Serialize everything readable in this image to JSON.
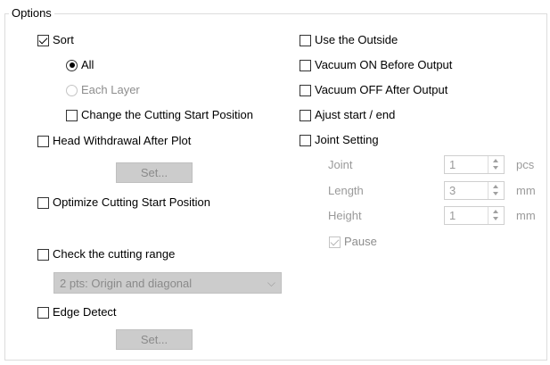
{
  "group_title": "Options",
  "left": {
    "sort": {
      "label": "Sort",
      "checked": true
    },
    "radio_all": {
      "label": "All",
      "checked": true
    },
    "radio_each_layer": {
      "label": "Each Layer",
      "checked": false
    },
    "change_start": {
      "label": "Change the Cutting Start Position",
      "checked": false
    },
    "head_withdrawal": {
      "label": "Head Withdrawal After Plot",
      "checked": false
    },
    "head_set_button": "Set...",
    "optimize_start": {
      "label": "Optimize Cutting Start Position",
      "checked": false
    },
    "check_range": {
      "label": "Check the cutting range",
      "checked": false
    },
    "range_select": "2 pts: Origin and diagonal",
    "edge_detect": {
      "label": "Edge Detect",
      "checked": false
    },
    "edge_set_button": "Set..."
  },
  "right": {
    "use_outside": {
      "label": "Use the Outside",
      "checked": false
    },
    "vacuum_on": {
      "label": "Vacuum ON Before Output",
      "checked": false
    },
    "vacuum_off": {
      "label": "Vacuum OFF After Output",
      "checked": false
    },
    "adjust": {
      "label": "Ajust start / end",
      "checked": false
    },
    "joint": {
      "label": "Joint Setting",
      "checked": false
    },
    "joint_fields": [
      {
        "label": "Joint",
        "value": "1",
        "unit": "pcs"
      },
      {
        "label": "Length",
        "value": "3",
        "unit": "mm"
      },
      {
        "label": "Height",
        "value": "1",
        "unit": "mm"
      }
    ],
    "pause": {
      "label": "Pause",
      "checked": true
    }
  }
}
